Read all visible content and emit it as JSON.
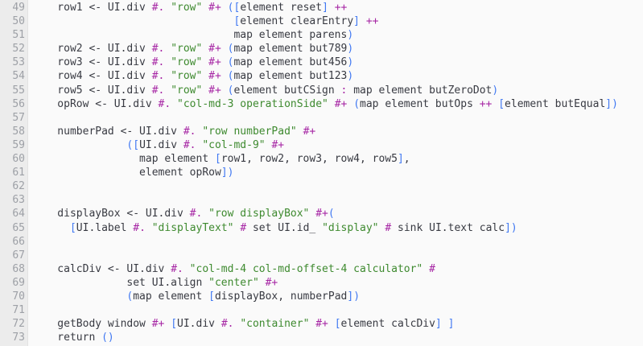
{
  "editor": {
    "colors": {
      "background": "#fafafa",
      "gutter": "#ececec",
      "line_number": "#9da0a6",
      "text": "#383a42",
      "string": "#3e8a2f",
      "operator": "#a626a4",
      "paren": "#4078f2"
    },
    "lines": [
      {
        "n": "49",
        "tokens": [
          {
            "c": "t",
            "v": "    row1 <- UI.div "
          },
          {
            "c": "o",
            "v": "#."
          },
          {
            "c": "t",
            "v": " "
          },
          {
            "c": "s",
            "v": "\"row\""
          },
          {
            "c": "t",
            "v": " "
          },
          {
            "c": "o",
            "v": "#+"
          },
          {
            "c": "t",
            "v": " "
          },
          {
            "c": "p",
            "v": "("
          },
          {
            "c": "p",
            "v": "["
          },
          {
            "c": "t",
            "v": "element reset"
          },
          {
            "c": "p",
            "v": "]"
          },
          {
            "c": "t",
            "v": " "
          },
          {
            "c": "o",
            "v": "++"
          }
        ]
      },
      {
        "n": "50",
        "tokens": [
          {
            "c": "t",
            "v": "                                "
          },
          {
            "c": "p",
            "v": "["
          },
          {
            "c": "t",
            "v": "element clearEntry"
          },
          {
            "c": "p",
            "v": "]"
          },
          {
            "c": "t",
            "v": " "
          },
          {
            "c": "o",
            "v": "++"
          }
        ]
      },
      {
        "n": "51",
        "tokens": [
          {
            "c": "t",
            "v": "                                map element parens"
          },
          {
            "c": "p",
            "v": ")"
          }
        ]
      },
      {
        "n": "52",
        "tokens": [
          {
            "c": "t",
            "v": "    row2 <- UI.div "
          },
          {
            "c": "o",
            "v": "#."
          },
          {
            "c": "t",
            "v": " "
          },
          {
            "c": "s",
            "v": "\"row\""
          },
          {
            "c": "t",
            "v": " "
          },
          {
            "c": "o",
            "v": "#+"
          },
          {
            "c": "t",
            "v": " "
          },
          {
            "c": "p",
            "v": "("
          },
          {
            "c": "t",
            "v": "map element but789"
          },
          {
            "c": "p",
            "v": ")"
          }
        ]
      },
      {
        "n": "53",
        "tokens": [
          {
            "c": "t",
            "v": "    row3 <- UI.div "
          },
          {
            "c": "o",
            "v": "#."
          },
          {
            "c": "t",
            "v": " "
          },
          {
            "c": "s",
            "v": "\"row\""
          },
          {
            "c": "t",
            "v": " "
          },
          {
            "c": "o",
            "v": "#+"
          },
          {
            "c": "t",
            "v": " "
          },
          {
            "c": "p",
            "v": "("
          },
          {
            "c": "t",
            "v": "map element but456"
          },
          {
            "c": "p",
            "v": ")"
          }
        ]
      },
      {
        "n": "54",
        "tokens": [
          {
            "c": "t",
            "v": "    row4 <- UI.div "
          },
          {
            "c": "o",
            "v": "#."
          },
          {
            "c": "t",
            "v": " "
          },
          {
            "c": "s",
            "v": "\"row\""
          },
          {
            "c": "t",
            "v": " "
          },
          {
            "c": "o",
            "v": "#+"
          },
          {
            "c": "t",
            "v": " "
          },
          {
            "c": "p",
            "v": "("
          },
          {
            "c": "t",
            "v": "map element but123"
          },
          {
            "c": "p",
            "v": ")"
          }
        ]
      },
      {
        "n": "55",
        "tokens": [
          {
            "c": "t",
            "v": "    row5 <- UI.div "
          },
          {
            "c": "o",
            "v": "#."
          },
          {
            "c": "t",
            "v": " "
          },
          {
            "c": "s",
            "v": "\"row\""
          },
          {
            "c": "t",
            "v": " "
          },
          {
            "c": "o",
            "v": "#+"
          },
          {
            "c": "t",
            "v": " "
          },
          {
            "c": "p",
            "v": "("
          },
          {
            "c": "t",
            "v": "element butCSign "
          },
          {
            "c": "o",
            "v": ":"
          },
          {
            "c": "t",
            "v": " map element butZeroDot"
          },
          {
            "c": "p",
            "v": ")"
          }
        ]
      },
      {
        "n": "56",
        "tokens": [
          {
            "c": "t",
            "v": "    opRow <- UI.div "
          },
          {
            "c": "o",
            "v": "#."
          },
          {
            "c": "t",
            "v": " "
          },
          {
            "c": "s",
            "v": "\"col-md-3 operationSide\""
          },
          {
            "c": "t",
            "v": " "
          },
          {
            "c": "o",
            "v": "#+"
          },
          {
            "c": "t",
            "v": " "
          },
          {
            "c": "p",
            "v": "("
          },
          {
            "c": "t",
            "v": "map element butOps "
          },
          {
            "c": "o",
            "v": "++"
          },
          {
            "c": "t",
            "v": " "
          },
          {
            "c": "p",
            "v": "["
          },
          {
            "c": "t",
            "v": "element butEqual"
          },
          {
            "c": "p",
            "v": "]"
          },
          {
            "c": "p",
            "v": ")"
          }
        ]
      },
      {
        "n": "57",
        "tokens": []
      },
      {
        "n": "58",
        "tokens": [
          {
            "c": "t",
            "v": "    numberPad <- UI.div "
          },
          {
            "c": "o",
            "v": "#."
          },
          {
            "c": "t",
            "v": " "
          },
          {
            "c": "s",
            "v": "\"row numberPad\""
          },
          {
            "c": "t",
            "v": " "
          },
          {
            "c": "o",
            "v": "#+"
          }
        ]
      },
      {
        "n": "59",
        "tokens": [
          {
            "c": "t",
            "v": "               "
          },
          {
            "c": "p",
            "v": "("
          },
          {
            "c": "p",
            "v": "["
          },
          {
            "c": "t",
            "v": "UI.div "
          },
          {
            "c": "o",
            "v": "#."
          },
          {
            "c": "t",
            "v": " "
          },
          {
            "c": "s",
            "v": "\"col-md-9\""
          },
          {
            "c": "t",
            "v": " "
          },
          {
            "c": "o",
            "v": "#+"
          }
        ]
      },
      {
        "n": "60",
        "tokens": [
          {
            "c": "t",
            "v": "                 map element "
          },
          {
            "c": "p",
            "v": "["
          },
          {
            "c": "t",
            "v": "row1, row2, row3, row4, row5"
          },
          {
            "c": "p",
            "v": "]"
          },
          {
            "c": "t",
            "v": ","
          }
        ]
      },
      {
        "n": "61",
        "tokens": [
          {
            "c": "t",
            "v": "                 element opRow"
          },
          {
            "c": "p",
            "v": "]"
          },
          {
            "c": "p",
            "v": ")"
          }
        ]
      },
      {
        "n": "62",
        "tokens": []
      },
      {
        "n": "63",
        "tokens": []
      },
      {
        "n": "64",
        "tokens": [
          {
            "c": "t",
            "v": "    displayBox <- UI.div "
          },
          {
            "c": "o",
            "v": "#."
          },
          {
            "c": "t",
            "v": " "
          },
          {
            "c": "s",
            "v": "\"row displayBox\""
          },
          {
            "c": "t",
            "v": " "
          },
          {
            "c": "o",
            "v": "#+"
          },
          {
            "c": "p",
            "v": "("
          }
        ]
      },
      {
        "n": "65",
        "tokens": [
          {
            "c": "t",
            "v": "      "
          },
          {
            "c": "p",
            "v": "["
          },
          {
            "c": "t",
            "v": "UI.label "
          },
          {
            "c": "o",
            "v": "#."
          },
          {
            "c": "t",
            "v": " "
          },
          {
            "c": "s",
            "v": "\"displayText\""
          },
          {
            "c": "t",
            "v": " "
          },
          {
            "c": "o",
            "v": "#"
          },
          {
            "c": "t",
            "v": " set UI.id_ "
          },
          {
            "c": "s",
            "v": "\"display\""
          },
          {
            "c": "t",
            "v": " "
          },
          {
            "c": "o",
            "v": "#"
          },
          {
            "c": "t",
            "v": " sink UI.text calc"
          },
          {
            "c": "p",
            "v": "]"
          },
          {
            "c": "p",
            "v": ")"
          }
        ]
      },
      {
        "n": "66",
        "tokens": []
      },
      {
        "n": "67",
        "tokens": []
      },
      {
        "n": "68",
        "tokens": [
          {
            "c": "t",
            "v": "    calcDiv <- UI.div "
          },
          {
            "c": "o",
            "v": "#."
          },
          {
            "c": "t",
            "v": " "
          },
          {
            "c": "s",
            "v": "\"col-md-4 col-md-offset-4 calculator\""
          },
          {
            "c": "t",
            "v": " "
          },
          {
            "c": "o",
            "v": "#"
          }
        ]
      },
      {
        "n": "69",
        "tokens": [
          {
            "c": "t",
            "v": "               set UI.align "
          },
          {
            "c": "s",
            "v": "\"center\""
          },
          {
            "c": "t",
            "v": " "
          },
          {
            "c": "o",
            "v": "#+"
          }
        ]
      },
      {
        "n": "70",
        "tokens": [
          {
            "c": "t",
            "v": "               "
          },
          {
            "c": "p",
            "v": "("
          },
          {
            "c": "t",
            "v": "map element "
          },
          {
            "c": "p",
            "v": "["
          },
          {
            "c": "t",
            "v": "displayBox, numberPad"
          },
          {
            "c": "p",
            "v": "]"
          },
          {
            "c": "p",
            "v": ")"
          }
        ]
      },
      {
        "n": "71",
        "tokens": []
      },
      {
        "n": "72",
        "tokens": [
          {
            "c": "t",
            "v": "    getBody window "
          },
          {
            "c": "o",
            "v": "#+"
          },
          {
            "c": "t",
            "v": " "
          },
          {
            "c": "p",
            "v": "["
          },
          {
            "c": "t",
            "v": "UI.div "
          },
          {
            "c": "o",
            "v": "#."
          },
          {
            "c": "t",
            "v": " "
          },
          {
            "c": "s",
            "v": "\"container\""
          },
          {
            "c": "t",
            "v": " "
          },
          {
            "c": "o",
            "v": "#+"
          },
          {
            "c": "t",
            "v": " "
          },
          {
            "c": "p",
            "v": "["
          },
          {
            "c": "t",
            "v": "element calcDiv"
          },
          {
            "c": "p",
            "v": "]"
          },
          {
            "c": "t",
            "v": " "
          },
          {
            "c": "p",
            "v": "]"
          }
        ]
      },
      {
        "n": "73",
        "tokens": [
          {
            "c": "t",
            "v": "    return "
          },
          {
            "c": "p",
            "v": "("
          },
          {
            "c": "p",
            "v": ")"
          }
        ]
      }
    ]
  }
}
